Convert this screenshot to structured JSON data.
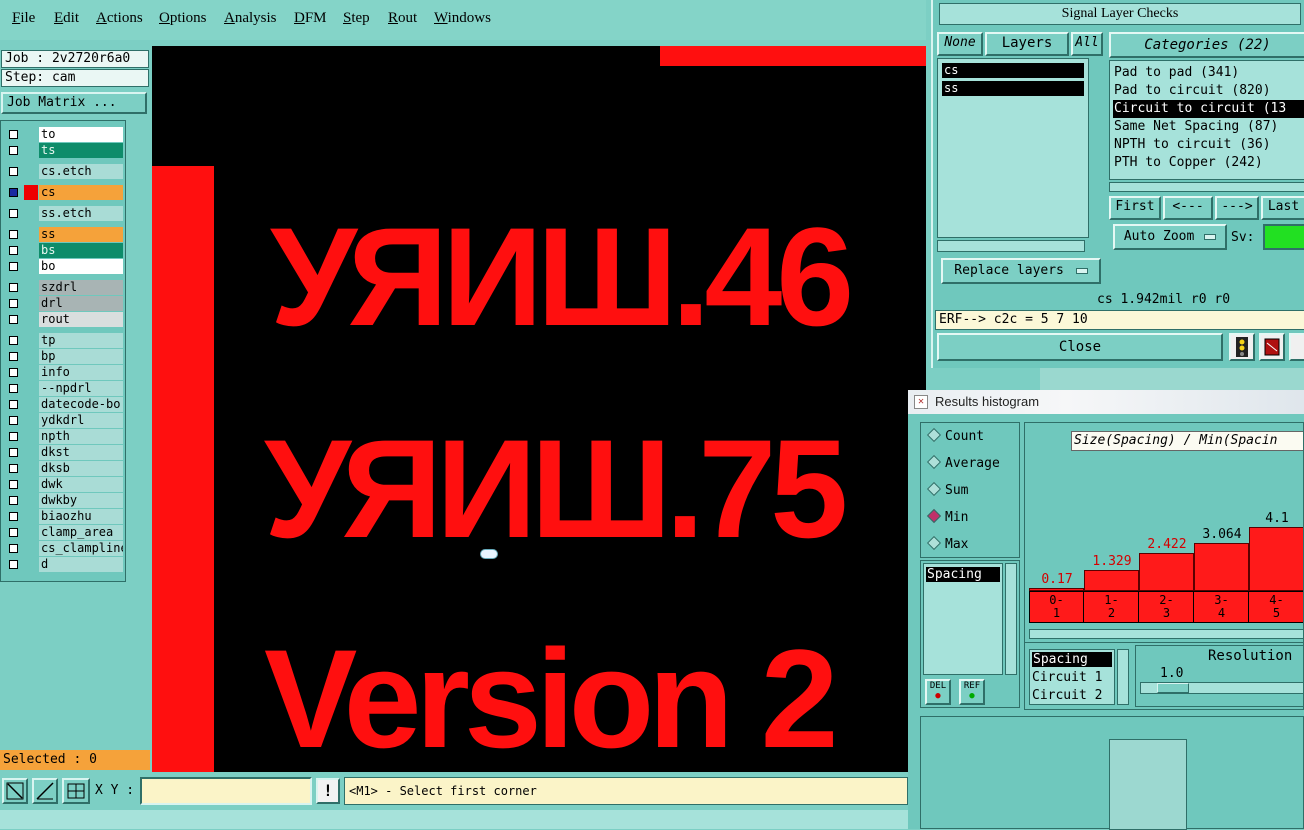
{
  "menu": [
    "File",
    "Edit",
    "Actions",
    "Options",
    "Analysis",
    "DFM",
    "Step",
    "Rout",
    "Windows"
  ],
  "job": {
    "job_label": "Job : 2v2720r6a0",
    "step_label": "Step: cam",
    "matrix_button": "Job Matrix ..."
  },
  "layers": [
    {
      "name": "to",
      "color": "white"
    },
    {
      "name": "ts",
      "color": "green"
    },
    {
      "name": "cs.etch",
      "color": "cyan"
    },
    {
      "name": "cs",
      "color": "orange"
    },
    {
      "name": "ss.etch",
      "color": "cyan"
    },
    {
      "name": "ss",
      "color": "orange"
    },
    {
      "name": "bs",
      "color": "green"
    },
    {
      "name": "bo",
      "color": "white"
    },
    {
      "name": "szdrl",
      "color": "gray"
    },
    {
      "name": "drl",
      "color": "gray"
    },
    {
      "name": "rout",
      "color": "lgray"
    },
    {
      "name": "tp",
      "color": "cyan"
    },
    {
      "name": "bp",
      "color": "cyan"
    },
    {
      "name": "info",
      "color": "cyan"
    },
    {
      "name": "--npdrl",
      "color": "cyan"
    },
    {
      "name": "datecode-bo",
      "color": "cyan"
    },
    {
      "name": "ydkdrl",
      "color": "cyan"
    },
    {
      "name": "npth",
      "color": "cyan"
    },
    {
      "name": "dkst",
      "color": "cyan"
    },
    {
      "name": "dksb",
      "color": "cyan"
    },
    {
      "name": "dwk",
      "color": "cyan"
    },
    {
      "name": "dwkby",
      "color": "cyan"
    },
    {
      "name": "biaozhu",
      "color": "cyan"
    },
    {
      "name": "clamp_area",
      "color": "cyan"
    },
    {
      "name": "cs_clampline",
      "color": "cyan"
    },
    {
      "name": "d",
      "color": "cyan"
    }
  ],
  "selected": "Selected : 0",
  "canvas_text": {
    "line1": "УЯИШ.46",
    "line2": "УЯИШ.75",
    "line3": "Version 2"
  },
  "bottom": {
    "xy_label": "X Y :",
    "xy_value": "",
    "prompt": "<M1> - Select first corner"
  },
  "signal": {
    "title": "Signal Layer Checks",
    "btn_none": "None",
    "btn_layers": "Layers",
    "btn_all": "All",
    "layer_list": [
      "cs",
      "ss"
    ],
    "categories_header": "Categories (22)",
    "categories": [
      "Pad to pad (341)",
      "Pad to circuit (820)",
      "Circuit to circuit (13",
      "Same Net Spacing (87)",
      "NPTH to circuit (36)",
      "PTH to Copper (242)"
    ],
    "nav": [
      "First",
      "<---",
      "--->",
      "Last"
    ],
    "auto_zoom": "Auto Zoom",
    "sv_label": "Sv:",
    "replace_layers": "Replace layers",
    "info_line": "cs 1.942mil  r0  r0",
    "erf_line": "ERF--> c2c = 5 7 10",
    "close": "Close"
  },
  "histogram": {
    "title": "Results histogram",
    "modes": [
      "Count",
      "Average",
      "Sum",
      "Min",
      "Max"
    ],
    "selected_mode": "Min",
    "list1": [
      "Spacing"
    ],
    "list2": [
      "Spacing",
      "Circuit 1",
      "Circuit 2"
    ],
    "btn_del": "DEL",
    "btn_ref": "REF",
    "resolution_label": "Resolution",
    "resolution_value": "1.0",
    "plot_title": "Size(Spacing) / Min(Spacin"
  },
  "chart_data": {
    "type": "bar",
    "title": "Size(Spacing) / Min(Spacin",
    "categories": [
      "0-1",
      "1-2",
      "2-3",
      "3-4",
      "4-5"
    ],
    "values": [
      0.17,
      1.329,
      2.422,
      3.064,
      4.1
    ],
    "labels": [
      "0.17",
      "1.329",
      "2.422",
      "3.064",
      "4.1"
    ],
    "bins": [
      [
        "0-",
        "1"
      ],
      [
        "1-",
        "2"
      ],
      [
        "2-",
        "3"
      ],
      [
        "3-",
        "4"
      ],
      [
        "4-",
        "5"
      ]
    ]
  },
  "colors": {
    "panel": "#7ccfc4",
    "canvas": "#000000",
    "feature": "#ff0f0f",
    "sv_indicator": "#22e022"
  }
}
